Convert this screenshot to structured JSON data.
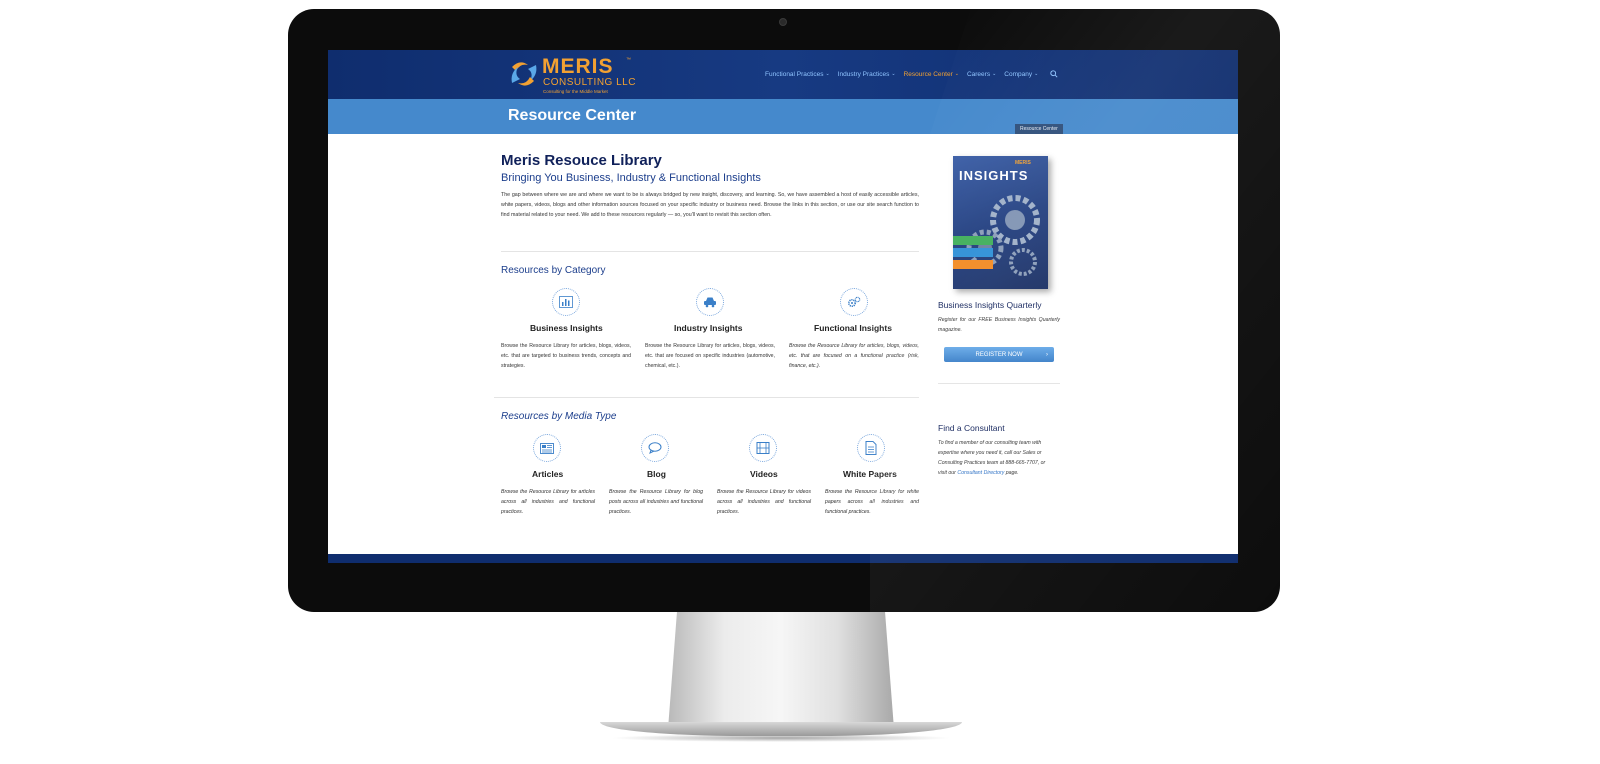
{
  "header": {
    "logo": {
      "wordmark": "MERIS",
      "tm": "™",
      "subline": "CONSULTING LLC",
      "tagline": "Consulting for the Middle Market"
    },
    "nav": [
      {
        "label": "Functional Practices",
        "active": false
      },
      {
        "label": "Industry Practices",
        "active": false
      },
      {
        "label": "Resource Center",
        "active": true
      },
      {
        "label": "Careers",
        "active": false
      },
      {
        "label": "Company",
        "active": false
      }
    ],
    "search_icon": "search-icon",
    "colors": {
      "bar": "#0f2d6e",
      "nav_link": "#8fc4ff",
      "nav_active": "#f2a132",
      "accent": "#f2a132"
    }
  },
  "title_bar": {
    "title": "Resource Center",
    "breadcrumb": "Resource Center",
    "color": "#4589cc"
  },
  "main": {
    "heading": "Meris Resouce Library",
    "subheading": "Bringing You Business, Industry & Functional Insights",
    "intro": "The gap between where we are and where we want to be is always bridged by new insight, discovery, and learning. So, we have assembled a host of easily accessible articles, white papers, videos, blogs and other information sources focused on your specific industry or business need. Browse the links in this section, or use our site search function to find material related to your need. We add to these resources regularly — so, you'll want to revisit this section often.",
    "by_category": {
      "heading": "Resources by Category",
      "items": [
        {
          "icon": "bar-chart-icon",
          "title": "Business Insights",
          "desc": "Browse the Resource Library for articles, blogs, videos, etc. that are targeted to business trends, concepts and strategies."
        },
        {
          "icon": "car-icon",
          "title": "Industry Insights",
          "desc": "Browse the Resource Library for articles, blogs, videos, etc. that are focused on specific industries (automotive, chemical, etc.)."
        },
        {
          "icon": "gears-icon",
          "title": "Functional Insights",
          "desc": "Browse the Resource Library for articles, blogs, videos, etc. that are focused on a functional practice (risk, finance, etc.)."
        }
      ]
    },
    "by_media": {
      "heading": "Resources by Media Type",
      "items": [
        {
          "icon": "newspaper-icon",
          "title": "Articles",
          "desc": "Browse the Resource Library for articles across all industries and functional practices."
        },
        {
          "icon": "speech-bubble-icon",
          "title": "Blog",
          "desc": "Browse the Resource Library for blog posts across all industries and functional practices."
        },
        {
          "icon": "film-icon",
          "title": "Videos",
          "desc": "Browse the Resource Library for videos across all industries and functional practices."
        },
        {
          "icon": "document-icon",
          "title": "White Papers",
          "desc": "Browse the Resource Library for white papers across all industries and functional practices."
        }
      ]
    }
  },
  "sidebar": {
    "cover": {
      "brand": "MERIS",
      "title": "INSIGHTS"
    },
    "quarterly": {
      "heading": "Business Insights Quarterly",
      "text": "Register for our FREE Business Insights Quarterly magazine.",
      "button": "REGISTER NOW",
      "button_arrow": "›"
    },
    "consultant": {
      "heading": "Find a Consultant",
      "text_before": "To find a member of our consulting team with expertise where you need it, call our Sales or Consulting Practices team at 888-665-7707, or visit our ",
      "link": "Consultant Directory",
      "text_after": " page."
    }
  }
}
